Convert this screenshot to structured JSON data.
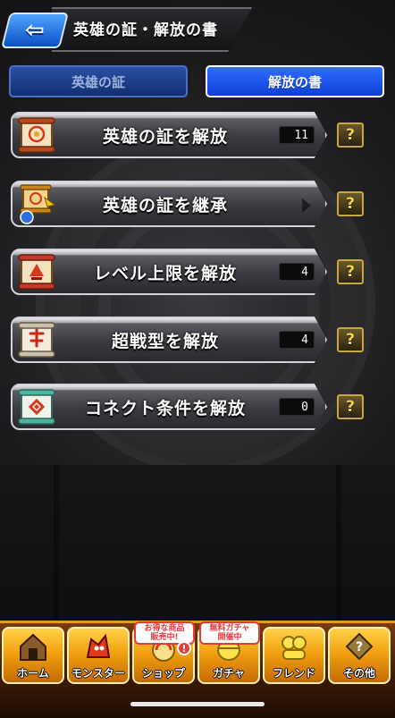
{
  "header": {
    "back_label": "⇦",
    "title": "英雄の証・解放の書"
  },
  "tabs": [
    {
      "label": "英雄の証",
      "active": false
    },
    {
      "label": "解放の書",
      "active": true
    }
  ],
  "rows": [
    {
      "label": "英雄の証を解放",
      "count": "11",
      "help": "?",
      "icon": "scroll-icon"
    },
    {
      "label": "英雄の証を継承",
      "count": "",
      "help": "?",
      "icon": "scroll-transfer-icon"
    },
    {
      "label": "レベル上限を解放",
      "count": "4",
      "help": "?",
      "icon": "scroll-icon"
    },
    {
      "label": "超戦型を解放",
      "count": "4",
      "help": "?",
      "icon": "scroll-icon"
    },
    {
      "label": "コネクト条件を解放",
      "count": "0",
      "help": "?",
      "icon": "scroll-icon"
    }
  ],
  "bottom_nav": {
    "items": [
      {
        "label": "ホーム",
        "icon": "home-icon"
      },
      {
        "label": "モンスター",
        "icon": "monster-icon"
      },
      {
        "label": "ショップ",
        "icon": "shop-icon",
        "badge": "お得な商品\n販売中!",
        "alert": "!"
      },
      {
        "label": "ガチャ",
        "icon": "gacha-icon",
        "badge": "無料ガチャ\n開催中"
      },
      {
        "label": "フレンド",
        "icon": "friend-icon"
      },
      {
        "label": "その他",
        "icon": "other-icon"
      }
    ]
  },
  "colors": {
    "accent_blue": "#2f6cff",
    "help_gold": "#f4d248",
    "nav_orange": "#f2a111"
  }
}
